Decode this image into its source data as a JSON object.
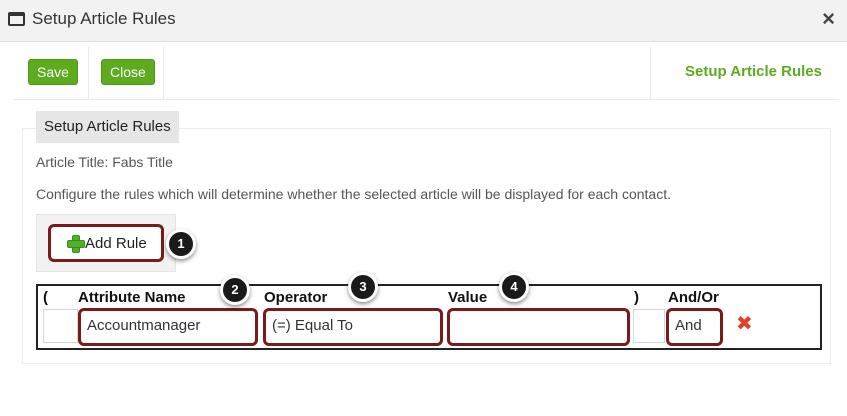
{
  "window": {
    "title": "Setup Article Rules",
    "icon": "window-icon",
    "close_icon": "close-icon",
    "close_glyph": "×"
  },
  "toolbar": {
    "save_label": "Save",
    "close_label": "Close",
    "heading": "Setup Article Rules",
    "accent": "#5eab1f"
  },
  "panel": {
    "tab_label": "Setup Article Rules",
    "article_title": "Article Title: Fabs Title",
    "description": "Configure the rules which will determine whether the selected article will be displayed for each contact."
  },
  "add_rule": {
    "label": "Add Rule",
    "icon": "plus-icon"
  },
  "badges": [
    "1",
    "2",
    "3",
    "4"
  ],
  "table": {
    "headers": [
      "(",
      "Attribute Name",
      "Operator",
      "Value",
      ")",
      "And/Or"
    ],
    "row": {
      "open_paren": "",
      "attribute": "Accountmanager",
      "operator": "(=) Equal To",
      "value": "",
      "close_paren": "",
      "and_or": "And",
      "delete_icon": "delete-icon",
      "delete_glyph": "✖"
    }
  }
}
